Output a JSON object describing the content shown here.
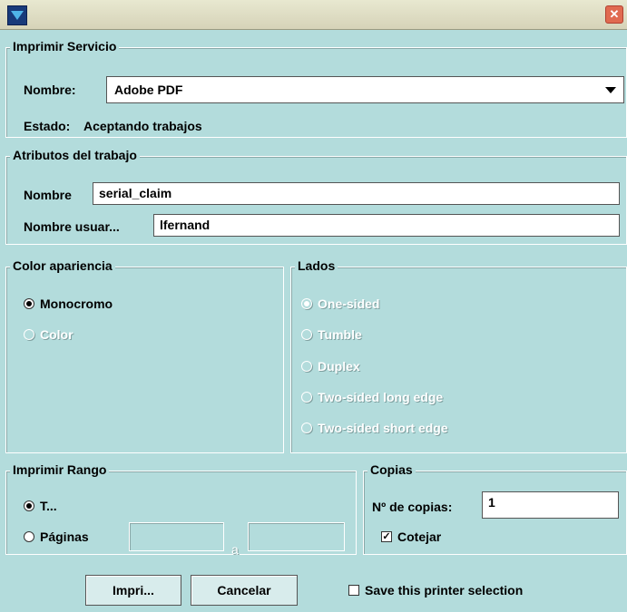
{
  "window": {
    "close_glyph": "✕"
  },
  "service": {
    "legend": "Imprimir Servicio",
    "name_label": "Nombre:",
    "name_value": "Adobe PDF",
    "status_label": "Estado:",
    "status_value": "Aceptando trabajos"
  },
  "job": {
    "legend": "Atributos del trabajo",
    "name_label": "Nombre",
    "name_value": "serial_claim",
    "user_label": "Nombre usuar...",
    "user_value": "lfernand"
  },
  "color": {
    "legend": "Color apariencia",
    "options": [
      {
        "label": "Monocromo",
        "selected": true,
        "enabled": true
      },
      {
        "label": "Color",
        "selected": false,
        "enabled": false
      }
    ]
  },
  "sides": {
    "legend": "Lados",
    "options": [
      {
        "label": "One-sided",
        "selected": true,
        "enabled": false
      },
      {
        "label": "Tumble",
        "selected": false,
        "enabled": false
      },
      {
        "label": "Duplex",
        "selected": false,
        "enabled": false
      },
      {
        "label": "Two-sided long edge",
        "selected": false,
        "enabled": false
      },
      {
        "label": "Two-sided short edge",
        "selected": false,
        "enabled": false
      }
    ]
  },
  "range": {
    "legend": "Imprimir Rango",
    "all_label": "T...",
    "pages_label": "Páginas",
    "to_label": "a",
    "from_value": "",
    "to_value": ""
  },
  "copies": {
    "legend": "Copias",
    "count_label": "Nº de copias:",
    "count_value": "1",
    "collate_label": "Cotejar",
    "collate_checked": true
  },
  "buttons": {
    "print_label": "Impri...",
    "cancel_label": "Cancelar",
    "save_selection_label": "Save this printer selection",
    "save_selection_checked": false
  }
}
